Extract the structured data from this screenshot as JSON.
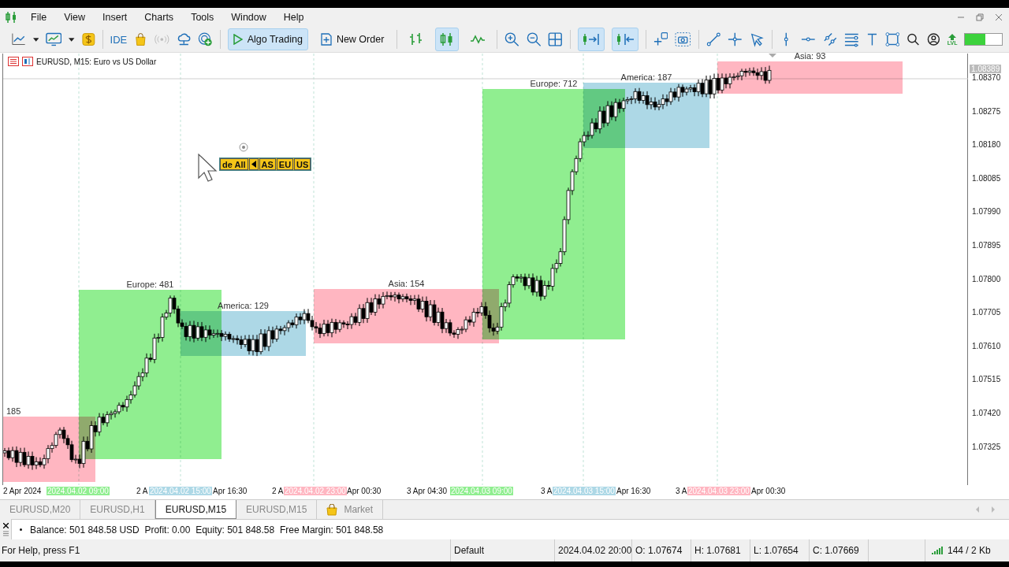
{
  "menu": [
    "File",
    "View",
    "Insert",
    "Charts",
    "Tools",
    "Window",
    "Help"
  ],
  "toolbar": {
    "ide": "IDE",
    "algo_trading": {
      "label": "Algo Trading",
      "on": true
    },
    "new_order": "New Order",
    "chart_modes": [
      {
        "kind": "bars",
        "on": false
      },
      {
        "kind": "candles",
        "on": true
      },
      {
        "kind": "line",
        "on": false
      }
    ],
    "scroll_modes": [
      {
        "kind": "autoscroll",
        "on": true
      },
      {
        "kind": "shift",
        "on": true
      }
    ],
    "lvl_label": "LVL",
    "meter": {
      "level": 0.55
    }
  },
  "chart": {
    "title": "EURUSD, M15:  Euro vs US Dollar",
    "session_buttons": [
      {
        "kind": "text",
        "label": "de All"
      },
      {
        "kind": "arrow"
      },
      {
        "kind": "text",
        "label": "AS"
      },
      {
        "kind": "text",
        "label": "EU"
      },
      {
        "kind": "text",
        "label": "US"
      }
    ],
    "sessions": [
      {
        "label": "185",
        "color": "#ffb6c1"
      },
      {
        "label": "Europe: 481",
        "color": "#90ee90"
      },
      {
        "label": "America: 129",
        "color": "#add8e6"
      },
      {
        "label": "Asia: 154",
        "color": "#ffb6c1"
      },
      {
        "label": "Europe: 712",
        "color": "#90ee90"
      },
      {
        "label": "America: 187",
        "color": "#add8e6"
      },
      {
        "label": "Asia: 93",
        "color": "#ffb6c1"
      }
    ],
    "current_price": "1.08389",
    "price_ticks": [
      "1.08370",
      "1.08275",
      "1.08180",
      "1.08085",
      "1.07990",
      "1.07895",
      "1.07800",
      "1.07705",
      "1.07610",
      "1.07515",
      "1.07420",
      "1.07325"
    ],
    "time_labels": [
      {
        "text": "2 Apr 2024"
      },
      {
        "text": "2024.04.02 09:00",
        "color": "#90ee90"
      },
      {
        "text": "2 A"
      },
      {
        "text": "2024.04.02 15:00",
        "color": "#add8e6"
      },
      {
        "text": "Apr 16:30"
      },
      {
        "text": "2 A"
      },
      {
        "text": "2024.04.02 23:00",
        "color": "#ffb6c1"
      },
      {
        "text": "Apr 00:30"
      },
      {
        "text": "3 Apr 04:30"
      },
      {
        "text": "2024.04.03 09:00",
        "color": "#90ee90"
      },
      {
        "text": "3 A"
      },
      {
        "text": "2024.04.03 15:00",
        "color": "#add8e6"
      },
      {
        "text": "Apr 16:30"
      },
      {
        "text": "3 A"
      },
      {
        "text": "2024.04.03 23:00",
        "color": "#ffb6c1"
      },
      {
        "text": "Apr 00:30"
      }
    ]
  },
  "tabs": [
    {
      "label": "EURUSD,M20",
      "selected": false
    },
    {
      "label": "EURUSD,H1",
      "selected": false
    },
    {
      "label": "EURUSD,M15",
      "selected": true
    },
    {
      "label": "EURUSD,M15",
      "selected": false
    },
    {
      "label": "Market",
      "selected": false,
      "kind": "market"
    }
  ],
  "account": "Balance: 501 848.58 USD  Profit: 0.00  Equity: 501 848.58  Free Margin: 501 848.58",
  "status_bar": {
    "help": "For Help, press F1",
    "profile": "Default",
    "time": "2024.04.02 20:00",
    "open": "O: 1.07674",
    "high": "H: 1.07681",
    "low": "L: 1.07654",
    "close": "C: 1.07669",
    "traffic": "144 / 2 Kb"
  }
}
